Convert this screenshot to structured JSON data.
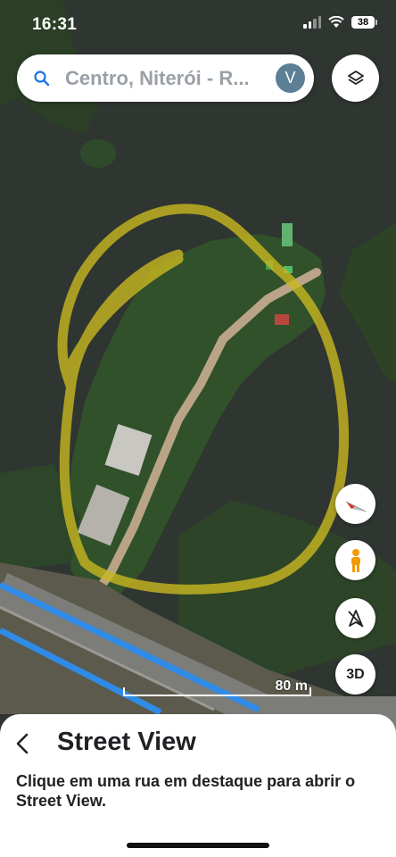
{
  "status_bar": {
    "time": "16:31",
    "battery": "38"
  },
  "search": {
    "query": "Centro, Niterói - R...",
    "avatar_letter": "V"
  },
  "map_controls": {
    "three_d_label": "3D"
  },
  "scale": {
    "label": "80 m"
  },
  "bottom_sheet": {
    "title": "Street View",
    "description": "Clique em uma rua em destaque para abrir o Street View."
  },
  "colors": {
    "highlight_road": "#2f8be6",
    "annotation": "#d3c21e",
    "water": "#2f3530",
    "vegetation": "#2c4a26"
  },
  "icons": [
    "search-icon",
    "layers-icon",
    "compass-icon",
    "pegman-icon",
    "navigation-icon",
    "back-arrow-icon"
  ]
}
